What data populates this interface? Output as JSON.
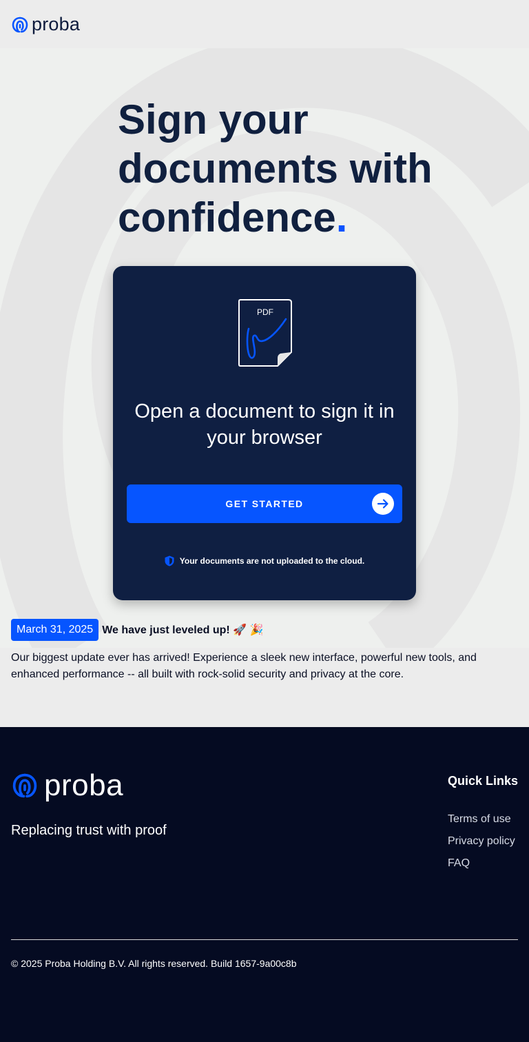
{
  "header": {
    "brand": "proba"
  },
  "hero": {
    "title": "Sign your documents with confidence",
    "title_dot": "."
  },
  "card": {
    "pdf_label": "PDF",
    "title": "Open a document to sign it in your browser",
    "cta_label": "GET STARTED",
    "privacy_prefix": "Your documents are ",
    "privacy_emph": "not",
    "privacy_suffix": " uploaded to the cloud."
  },
  "news": {
    "date": "March 31, 2025",
    "title": "We have just leveled up! 🚀 🎉",
    "body": "Our biggest update ever has arrived! Experience a sleek new interface, powerful new tools, and enhanced performance -- all built with rock-solid security and privacy at the core."
  },
  "footer": {
    "brand": "proba",
    "tagline": "Replacing trust with proof",
    "quick_links_title": "Quick Links",
    "links": [
      "Terms of use",
      "Privacy policy",
      "FAQ"
    ],
    "copyright": "© 2025 Proba Holding B.V. All rights reserved. Build 1657-9a00c8b"
  },
  "colors": {
    "brand_blue": "#0655ff",
    "navy": "#0f1f42",
    "footer_bg": "#050b22"
  },
  "icons": [
    "proba-logo-icon",
    "pdf-document-icon",
    "arrow-right-icon",
    "shield-icon"
  ]
}
